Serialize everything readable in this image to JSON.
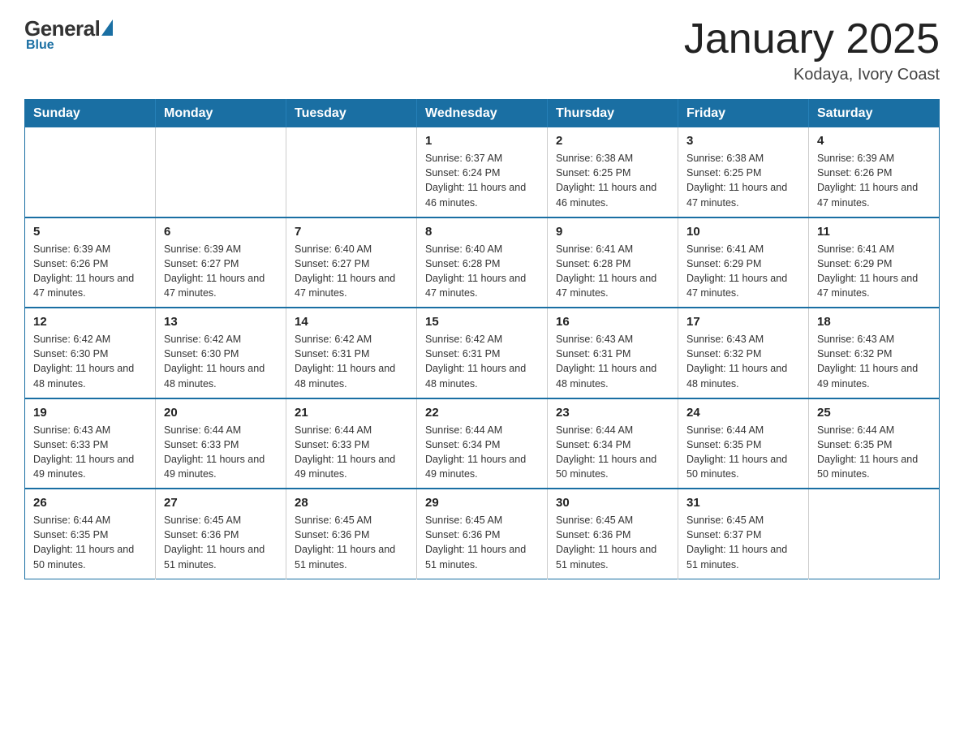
{
  "header": {
    "logo_general": "General",
    "logo_blue": "Blue",
    "month_title": "January 2025",
    "location": "Kodaya, Ivory Coast"
  },
  "weekdays": [
    "Sunday",
    "Monday",
    "Tuesday",
    "Wednesday",
    "Thursday",
    "Friday",
    "Saturday"
  ],
  "weeks": [
    [
      {
        "day": "",
        "info": ""
      },
      {
        "day": "",
        "info": ""
      },
      {
        "day": "",
        "info": ""
      },
      {
        "day": "1",
        "info": "Sunrise: 6:37 AM\nSunset: 6:24 PM\nDaylight: 11 hours and 46 minutes."
      },
      {
        "day": "2",
        "info": "Sunrise: 6:38 AM\nSunset: 6:25 PM\nDaylight: 11 hours and 46 minutes."
      },
      {
        "day": "3",
        "info": "Sunrise: 6:38 AM\nSunset: 6:25 PM\nDaylight: 11 hours and 47 minutes."
      },
      {
        "day": "4",
        "info": "Sunrise: 6:39 AM\nSunset: 6:26 PM\nDaylight: 11 hours and 47 minutes."
      }
    ],
    [
      {
        "day": "5",
        "info": "Sunrise: 6:39 AM\nSunset: 6:26 PM\nDaylight: 11 hours and 47 minutes."
      },
      {
        "day": "6",
        "info": "Sunrise: 6:39 AM\nSunset: 6:27 PM\nDaylight: 11 hours and 47 minutes."
      },
      {
        "day": "7",
        "info": "Sunrise: 6:40 AM\nSunset: 6:27 PM\nDaylight: 11 hours and 47 minutes."
      },
      {
        "day": "8",
        "info": "Sunrise: 6:40 AM\nSunset: 6:28 PM\nDaylight: 11 hours and 47 minutes."
      },
      {
        "day": "9",
        "info": "Sunrise: 6:41 AM\nSunset: 6:28 PM\nDaylight: 11 hours and 47 minutes."
      },
      {
        "day": "10",
        "info": "Sunrise: 6:41 AM\nSunset: 6:29 PM\nDaylight: 11 hours and 47 minutes."
      },
      {
        "day": "11",
        "info": "Sunrise: 6:41 AM\nSunset: 6:29 PM\nDaylight: 11 hours and 47 minutes."
      }
    ],
    [
      {
        "day": "12",
        "info": "Sunrise: 6:42 AM\nSunset: 6:30 PM\nDaylight: 11 hours and 48 minutes."
      },
      {
        "day": "13",
        "info": "Sunrise: 6:42 AM\nSunset: 6:30 PM\nDaylight: 11 hours and 48 minutes."
      },
      {
        "day": "14",
        "info": "Sunrise: 6:42 AM\nSunset: 6:31 PM\nDaylight: 11 hours and 48 minutes."
      },
      {
        "day": "15",
        "info": "Sunrise: 6:42 AM\nSunset: 6:31 PM\nDaylight: 11 hours and 48 minutes."
      },
      {
        "day": "16",
        "info": "Sunrise: 6:43 AM\nSunset: 6:31 PM\nDaylight: 11 hours and 48 minutes."
      },
      {
        "day": "17",
        "info": "Sunrise: 6:43 AM\nSunset: 6:32 PM\nDaylight: 11 hours and 48 minutes."
      },
      {
        "day": "18",
        "info": "Sunrise: 6:43 AM\nSunset: 6:32 PM\nDaylight: 11 hours and 49 minutes."
      }
    ],
    [
      {
        "day": "19",
        "info": "Sunrise: 6:43 AM\nSunset: 6:33 PM\nDaylight: 11 hours and 49 minutes."
      },
      {
        "day": "20",
        "info": "Sunrise: 6:44 AM\nSunset: 6:33 PM\nDaylight: 11 hours and 49 minutes."
      },
      {
        "day": "21",
        "info": "Sunrise: 6:44 AM\nSunset: 6:33 PM\nDaylight: 11 hours and 49 minutes."
      },
      {
        "day": "22",
        "info": "Sunrise: 6:44 AM\nSunset: 6:34 PM\nDaylight: 11 hours and 49 minutes."
      },
      {
        "day": "23",
        "info": "Sunrise: 6:44 AM\nSunset: 6:34 PM\nDaylight: 11 hours and 50 minutes."
      },
      {
        "day": "24",
        "info": "Sunrise: 6:44 AM\nSunset: 6:35 PM\nDaylight: 11 hours and 50 minutes."
      },
      {
        "day": "25",
        "info": "Sunrise: 6:44 AM\nSunset: 6:35 PM\nDaylight: 11 hours and 50 minutes."
      }
    ],
    [
      {
        "day": "26",
        "info": "Sunrise: 6:44 AM\nSunset: 6:35 PM\nDaylight: 11 hours and 50 minutes."
      },
      {
        "day": "27",
        "info": "Sunrise: 6:45 AM\nSunset: 6:36 PM\nDaylight: 11 hours and 51 minutes."
      },
      {
        "day": "28",
        "info": "Sunrise: 6:45 AM\nSunset: 6:36 PM\nDaylight: 11 hours and 51 minutes."
      },
      {
        "day": "29",
        "info": "Sunrise: 6:45 AM\nSunset: 6:36 PM\nDaylight: 11 hours and 51 minutes."
      },
      {
        "day": "30",
        "info": "Sunrise: 6:45 AM\nSunset: 6:36 PM\nDaylight: 11 hours and 51 minutes."
      },
      {
        "day": "31",
        "info": "Sunrise: 6:45 AM\nSunset: 6:37 PM\nDaylight: 11 hours and 51 minutes."
      },
      {
        "day": "",
        "info": ""
      }
    ]
  ]
}
